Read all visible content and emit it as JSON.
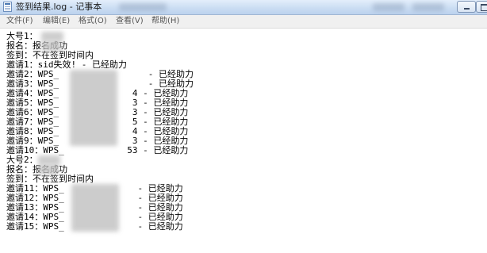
{
  "window": {
    "title": "签到结果.log - 记事本",
    "icon": "notepad-icon",
    "controls": [
      "minimize-icon",
      "maximize-icon"
    ]
  },
  "menu": [
    "文件(F)",
    "编辑(E)",
    "格式(O)",
    "查看(V)",
    "帮助(H)"
  ],
  "lines": [
    "大号1：",
    "报名：报名成功",
    "签到：不在签到时间内",
    "邀请1：sid失效! - 已经助力",
    "邀请2：WPS_                 - 已经助力",
    "邀请3：WPS_                 - 已经助力",
    "邀请4：WPS_              4 - 已经助力",
    "邀请5：WPS_              3 - 已经助力",
    "邀请6：WPS_              3 - 已经助力",
    "邀请7：WPS_              5 - 已经助力",
    "邀请8：WPS_              4 - 已经助力",
    "邀请9：WPS_              3 - 已经助力",
    "邀请10：WPS_            53 - 已经助力",
    "大号2：",
    "报名：报名成功",
    "签到：不在签到时间内",
    "邀请11：WPS_              - 已经助力",
    "邀请12：WPS_              - 已经助力",
    "邀请13：WPS_              - 已经助力",
    "邀请14：WPS_              - 已经助力",
    "邀请15：WPS_              - 已经助力"
  ]
}
